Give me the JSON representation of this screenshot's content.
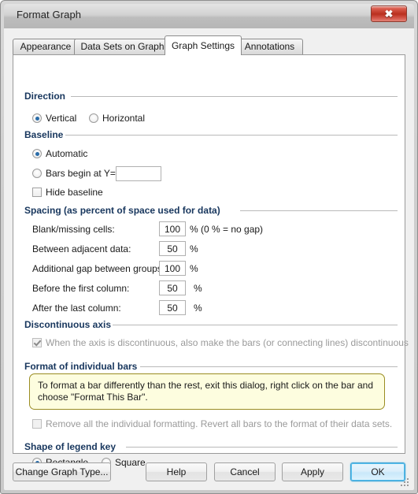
{
  "window": {
    "title": "Format Graph",
    "close_label": "✖"
  },
  "tabs": [
    {
      "label": "Appearance",
      "selected": false
    },
    {
      "label": "Data Sets on Graph",
      "selected": false
    },
    {
      "label": "Graph Settings",
      "selected": true
    },
    {
      "label": "Annotations",
      "selected": false
    }
  ],
  "direction": {
    "group_label": "Direction",
    "options": [
      {
        "label": "Vertical",
        "selected": true
      },
      {
        "label": "Horizontal",
        "selected": false
      }
    ]
  },
  "baseline": {
    "group_label": "Baseline",
    "options": [
      {
        "label": "Automatic",
        "selected": true
      },
      {
        "label": "Bars begin at Y=",
        "selected": false
      }
    ],
    "bars_begin_value": "",
    "hide_baseline": {
      "label": "Hide baseline",
      "checked": false
    }
  },
  "spacing": {
    "group_label": "Spacing (as percent of space used for data)",
    "rows": [
      {
        "label": "Blank/missing cells:",
        "value": "100",
        "unit": "% (0 % = no gap)"
      },
      {
        "label": "Between adjacent data:",
        "value": "50",
        "unit": "%"
      },
      {
        "label": "Additional gap between groups:",
        "value": "100",
        "unit": "%"
      },
      {
        "label": "Before the first column:",
        "value": "50",
        "unit": "%"
      },
      {
        "label": "After the last column:",
        "value": "50",
        "unit": "%"
      }
    ]
  },
  "discontinuous": {
    "group_label": "Discontinuous axis",
    "checkbox": {
      "label": "When the axis is discontinuous, also make the bars (or connecting lines) discontinuous",
      "checked": true,
      "disabled": true
    }
  },
  "individual_bars": {
    "group_label": "Format of individual bars",
    "tip": "To format a bar differently than the rest, exit this dialog, right click on the bar and choose \"Format This Bar\".",
    "checkbox": {
      "label": "Remove all the individual formatting. Revert all bars to the format of their data sets.",
      "checked": false,
      "disabled": true
    }
  },
  "legend_key": {
    "group_label": "Shape of legend key",
    "options": [
      {
        "label": "Rectangle",
        "selected": true
      },
      {
        "label": "Square",
        "selected": false
      }
    ]
  },
  "buttons": {
    "change_graph_type": "Change Graph Type...",
    "help": "Help",
    "cancel": "Cancel",
    "apply": "Apply",
    "ok": "OK"
  },
  "colors": {
    "group_header": "#17365d",
    "accent": "#2a6ca8",
    "default_button_border": "#3f9fd0",
    "tip_background": "#fdfddf",
    "tip_border": "#9a8c22",
    "close_button": "#b92f1e"
  }
}
